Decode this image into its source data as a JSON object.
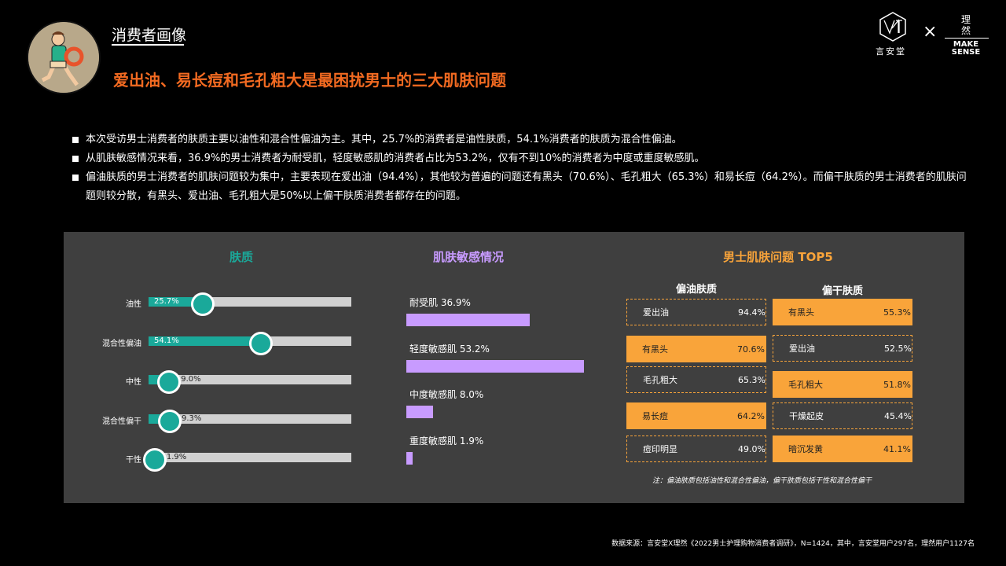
{
  "header": {
    "section_title": "消费者画像",
    "headline": "爱出油、易长痘和毛孔粗大是最困扰男士的三大肌肤问题",
    "logo_left_text": "言安堂",
    "logo_x": "×",
    "logo_right_cn": "理然",
    "logo_right_en_1": "MAKE",
    "logo_right_en_2": "SENSE"
  },
  "bullets": [
    "本次受访男士消费者的肤质主要以油性和混合性偏油为主。其中，25.7%的消费者是油性肤质，54.1%消费者的肤质为混合性偏油。",
    "从肌肤敏感情况来看，36.9%的男士消费者为耐受肌，轻度敏感肌的消费者占比为53.2%，仅有不到10%的消费者为中度或重度敏感肌。",
    "偏油肤质的男士消费者的肌肤问题较为集中，主要表现在爱出油（94.4%），其他较为普遍的问题还有黑头（70.6%）、毛孔粗大（65.3%）和易长痘（64.2%）。而偏干肤质的男士消费者的肌肤问题则较分散，有黑头、爱出油、毛孔粗大是50%以上偏干肤质消费者都存在的问题。"
  ],
  "colors": {
    "accent_orange": "#f26a21",
    "teal": "#1aa99a",
    "purple": "#c89bff",
    "top5_orange": "#f9a43a",
    "panel_bg": "#3f3f3f"
  },
  "chart_data": [
    {
      "type": "bar",
      "title": "肤质",
      "categories": [
        "油性",
        "混合性偏油",
        "中性",
        "混合性偏干",
        "干性"
      ],
      "values": [
        25.7,
        54.1,
        9.0,
        9.3,
        1.9
      ],
      "value_labels": [
        "25.7%",
        "54.1%",
        "9.0%",
        "9.3%",
        "1.9%"
      ],
      "ylim": [
        0,
        100
      ]
    },
    {
      "type": "bar",
      "title": "肌肤敏感情况",
      "categories": [
        "耐受肌",
        "轻度敏感肌",
        "中度敏感肌",
        "重度敏感肌"
      ],
      "values": [
        36.9,
        53.2,
        8.0,
        1.9
      ],
      "labels": [
        "耐受肌 36.9%",
        "轻度敏感肌 53.2%",
        "中度敏感肌 8.0%",
        "重度敏感肌 1.9%"
      ]
    },
    {
      "type": "table",
      "title": "男士肌肤问题 TOP5",
      "columns": [
        {
          "name": "偏油肤质",
          "rows": [
            {
              "item": "爱出油",
              "value": "94.4%",
              "style": "dash"
            },
            {
              "item": "有黑头",
              "value": "70.6%",
              "style": "solid"
            },
            {
              "item": "毛孔粗大",
              "value": "65.3%",
              "style": "dash"
            },
            {
              "item": "易长痘",
              "value": "64.2%",
              "style": "solid"
            },
            {
              "item": "痘印明显",
              "value": "49.0%",
              "style": "dash"
            }
          ]
        },
        {
          "name": "偏干肤质",
          "rows": [
            {
              "item": "有黑头",
              "value": "55.3%",
              "style": "solid"
            },
            {
              "item": "爱出油",
              "value": "52.5%",
              "style": "dash"
            },
            {
              "item": "毛孔粗大",
              "value": "51.8%",
              "style": "solid"
            },
            {
              "item": "干燥起皮",
              "value": "45.4%",
              "style": "dash"
            },
            {
              "item": "暗沉发黄",
              "value": "41.1%",
              "style": "solid"
            }
          ]
        }
      ],
      "note": "注：偏油肤质包括油性和混合性偏油，偏干肤质包括干性和混合性偏干"
    }
  ],
  "source": "数据来源：言安堂X理然《2022男士护理购物消费者调研》，N=1424，其中，言安堂用户297名，理然用户1127名"
}
